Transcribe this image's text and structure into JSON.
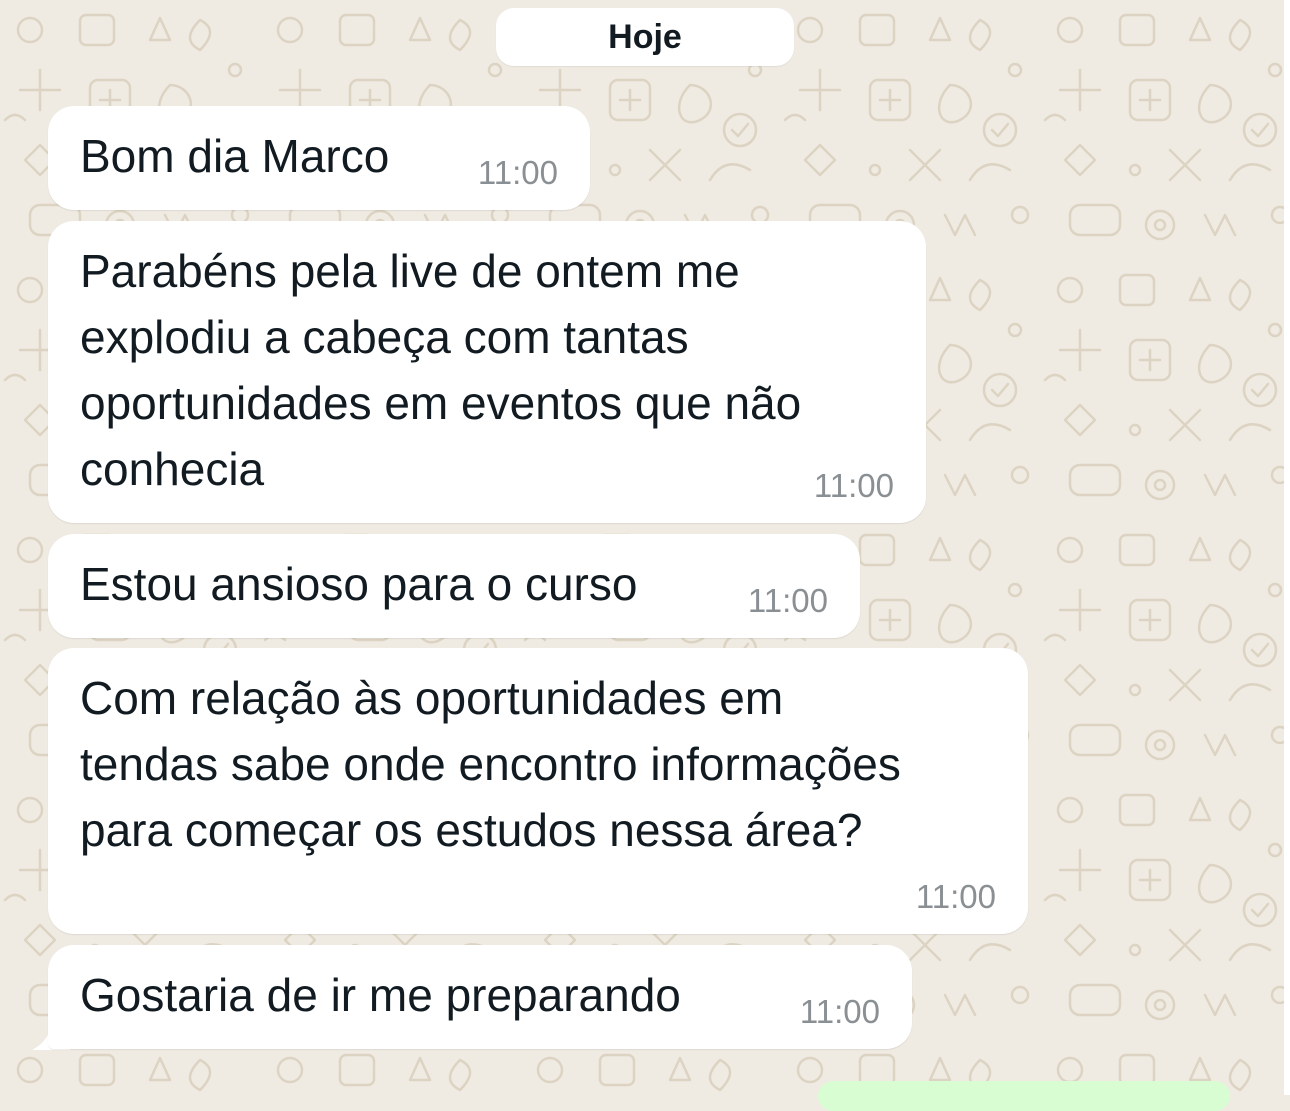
{
  "chat": {
    "date_label": "Hoje",
    "messages": [
      {
        "lines": [
          "Bom dia Marco"
        ],
        "time": "11:00"
      },
      {
        "lines": [
          "Parabéns pela live de ontem me",
          "explodiu a cabeça com tantas",
          "oportunidades em eventos que não",
          "conhecia"
        ],
        "time": "11:00"
      },
      {
        "lines": [
          "Estou ansioso para o curso"
        ],
        "time": "11:00"
      },
      {
        "lines": [
          "Com relação às oportunidades em",
          "tendas sabe onde encontro informações",
          "para começar os estudos nessa área?"
        ],
        "time": "11:00"
      },
      {
        "lines": [
          "Gostaria de ir me preparando"
        ],
        "time": "11:00"
      }
    ]
  },
  "colors": {
    "background": "#efeae2",
    "incoming_bubble": "#ffffff",
    "outgoing_bubble": "#d9fdd3",
    "text": "#111b21",
    "timestamp": "#8a8f93"
  }
}
